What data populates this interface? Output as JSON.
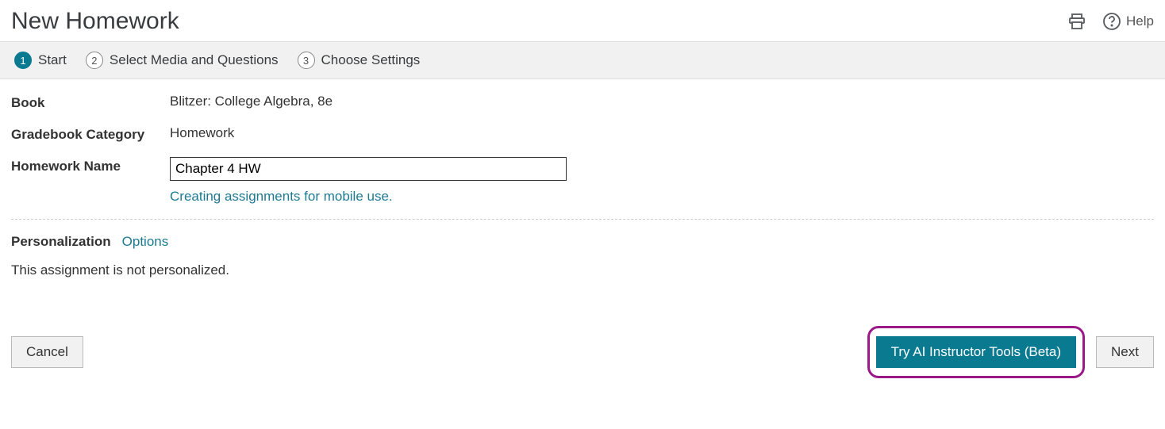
{
  "header": {
    "title": "New Homework",
    "help_label": "Help"
  },
  "steps": [
    {
      "num": "1",
      "label": "Start",
      "active": true
    },
    {
      "num": "2",
      "label": "Select Media and Questions",
      "active": false
    },
    {
      "num": "3",
      "label": "Choose Settings",
      "active": false
    }
  ],
  "form": {
    "book_label": "Book",
    "book_value": "Blitzer: College Algebra, 8e",
    "category_label": "Gradebook Category",
    "category_value": "Homework",
    "name_label": "Homework Name",
    "name_value": "Chapter 4 HW",
    "mobile_hint": "Creating assignments for mobile use."
  },
  "personalization": {
    "label": "Personalization",
    "options_link": "Options",
    "status": "This assignment is not personalized."
  },
  "footer": {
    "cancel": "Cancel",
    "ai_tools": "Try AI Instructor Tools (Beta)",
    "next": "Next"
  }
}
